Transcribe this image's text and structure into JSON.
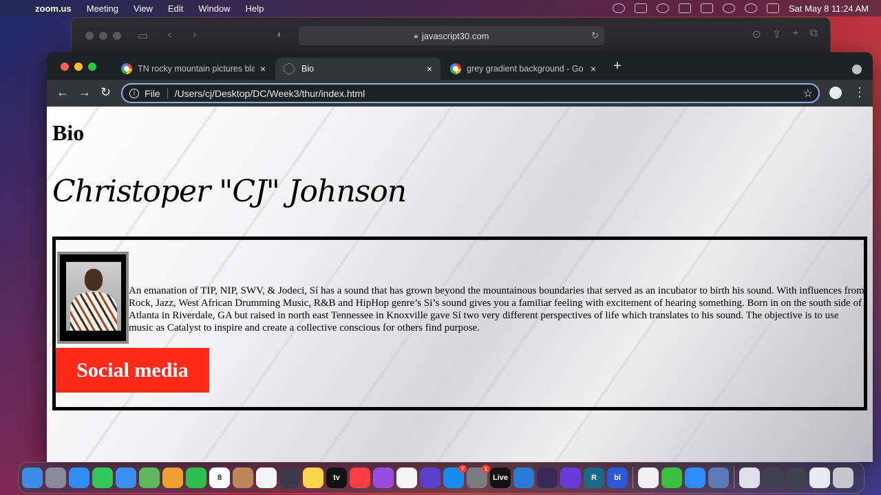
{
  "menubar": {
    "app_name": "zoom.us",
    "items": [
      "Meeting",
      "View",
      "Edit",
      "Window",
      "Help"
    ],
    "clock": "Sat May 8  11:24 AM"
  },
  "safari": {
    "url": "javascript30.com"
  },
  "chrome": {
    "tabs": [
      {
        "title": "TN rocky mountain pictures bla",
        "close": "×"
      },
      {
        "title": "Bio",
        "close": "×"
      },
      {
        "title": "grey gradient background - Go",
        "close": "×"
      }
    ],
    "new_tab": "+",
    "address": {
      "scheme_label": "File",
      "path": "/Users/cj/Desktop/DC/Week3/thur/index.html"
    }
  },
  "page": {
    "heading": "Bio",
    "name": "Christoper \"CJ\" Johnson",
    "bio": "An emanation of TIP, NIP, SWV, & Jodeci, Sí has a sound that has grown beyond the mountainous boundaries that served as an incubator to birth his sound. With influences from Rock, Jazz, West African Drumming Music, R&B and HipHop genre’s Si’s sound gives you a familiar feeling with excitement of hearing something. Born in on the south side of Atlanta in Riverdale, GA but raised in north east Tennessee in Knoxville gave Sí two very different perspectives of life which translates to his sound. The objective is to use music as Catalyst to inspire and create a collective conscious for others find purpose.",
    "social_button": "Social media"
  },
  "dock": {
    "apps": [
      {
        "name": "finder",
        "color": "#3a8ee6"
      },
      {
        "name": "launchpad",
        "color": "#8a8a9a"
      },
      {
        "name": "safari",
        "color": "#2f8cf0"
      },
      {
        "name": "messages",
        "color": "#34c759"
      },
      {
        "name": "mail",
        "color": "#3a90f0"
      },
      {
        "name": "maps",
        "color": "#5cb85c"
      },
      {
        "name": "photos",
        "color": "#f0a030"
      },
      {
        "name": "facetime",
        "color": "#2fbf4f"
      },
      {
        "name": "calendar",
        "color": "#ffffff",
        "label": "8"
      },
      {
        "name": "contacts",
        "color": "#b8875a"
      },
      {
        "name": "reminders",
        "color": "#f5f5f5"
      },
      {
        "name": "quicktime",
        "color": "#3a3a4a"
      },
      {
        "name": "notes",
        "color": "#f7d54a"
      },
      {
        "name": "apple-tv",
        "color": "#111111",
        "label": "tv"
      },
      {
        "name": "music",
        "color": "#fc3c44"
      },
      {
        "name": "podcasts",
        "color": "#9b4de0"
      },
      {
        "name": "news",
        "color": "#f5f5f5"
      },
      {
        "name": "imovie",
        "color": "#5a3fc8"
      },
      {
        "name": "app-store",
        "color": "#1a8cf0",
        "badge": "7"
      },
      {
        "name": "system-preferences",
        "color": "#7a7a82",
        "badge": "1"
      },
      {
        "name": "ableton-live",
        "color": "#111111",
        "label": "Live"
      },
      {
        "name": "vscode",
        "color": "#2a7ad8"
      },
      {
        "name": "app-a",
        "color": "#3a2a5a"
      },
      {
        "name": "app-b",
        "color": "#6a3ad8"
      },
      {
        "name": "app-r",
        "color": "#1a6a8a",
        "label": "R"
      },
      {
        "name": "app-bl",
        "color": "#2a5ad8",
        "label": "bl"
      },
      {
        "name": "chrome",
        "color": "#f0f0f0"
      },
      {
        "name": "app-silhouette",
        "color": "#3ac040"
      },
      {
        "name": "zoom",
        "color": "#2d8cff"
      },
      {
        "name": "app-window",
        "color": "#5a7ab8"
      },
      {
        "name": "downloads",
        "color": "#e0e0e8"
      },
      {
        "name": "folder-1",
        "color": "#404050"
      },
      {
        "name": "folder-2",
        "color": "#404050"
      },
      {
        "name": "folder-3",
        "color": "#e8e8f0"
      },
      {
        "name": "trash",
        "color": "#c8c8cc"
      }
    ]
  }
}
